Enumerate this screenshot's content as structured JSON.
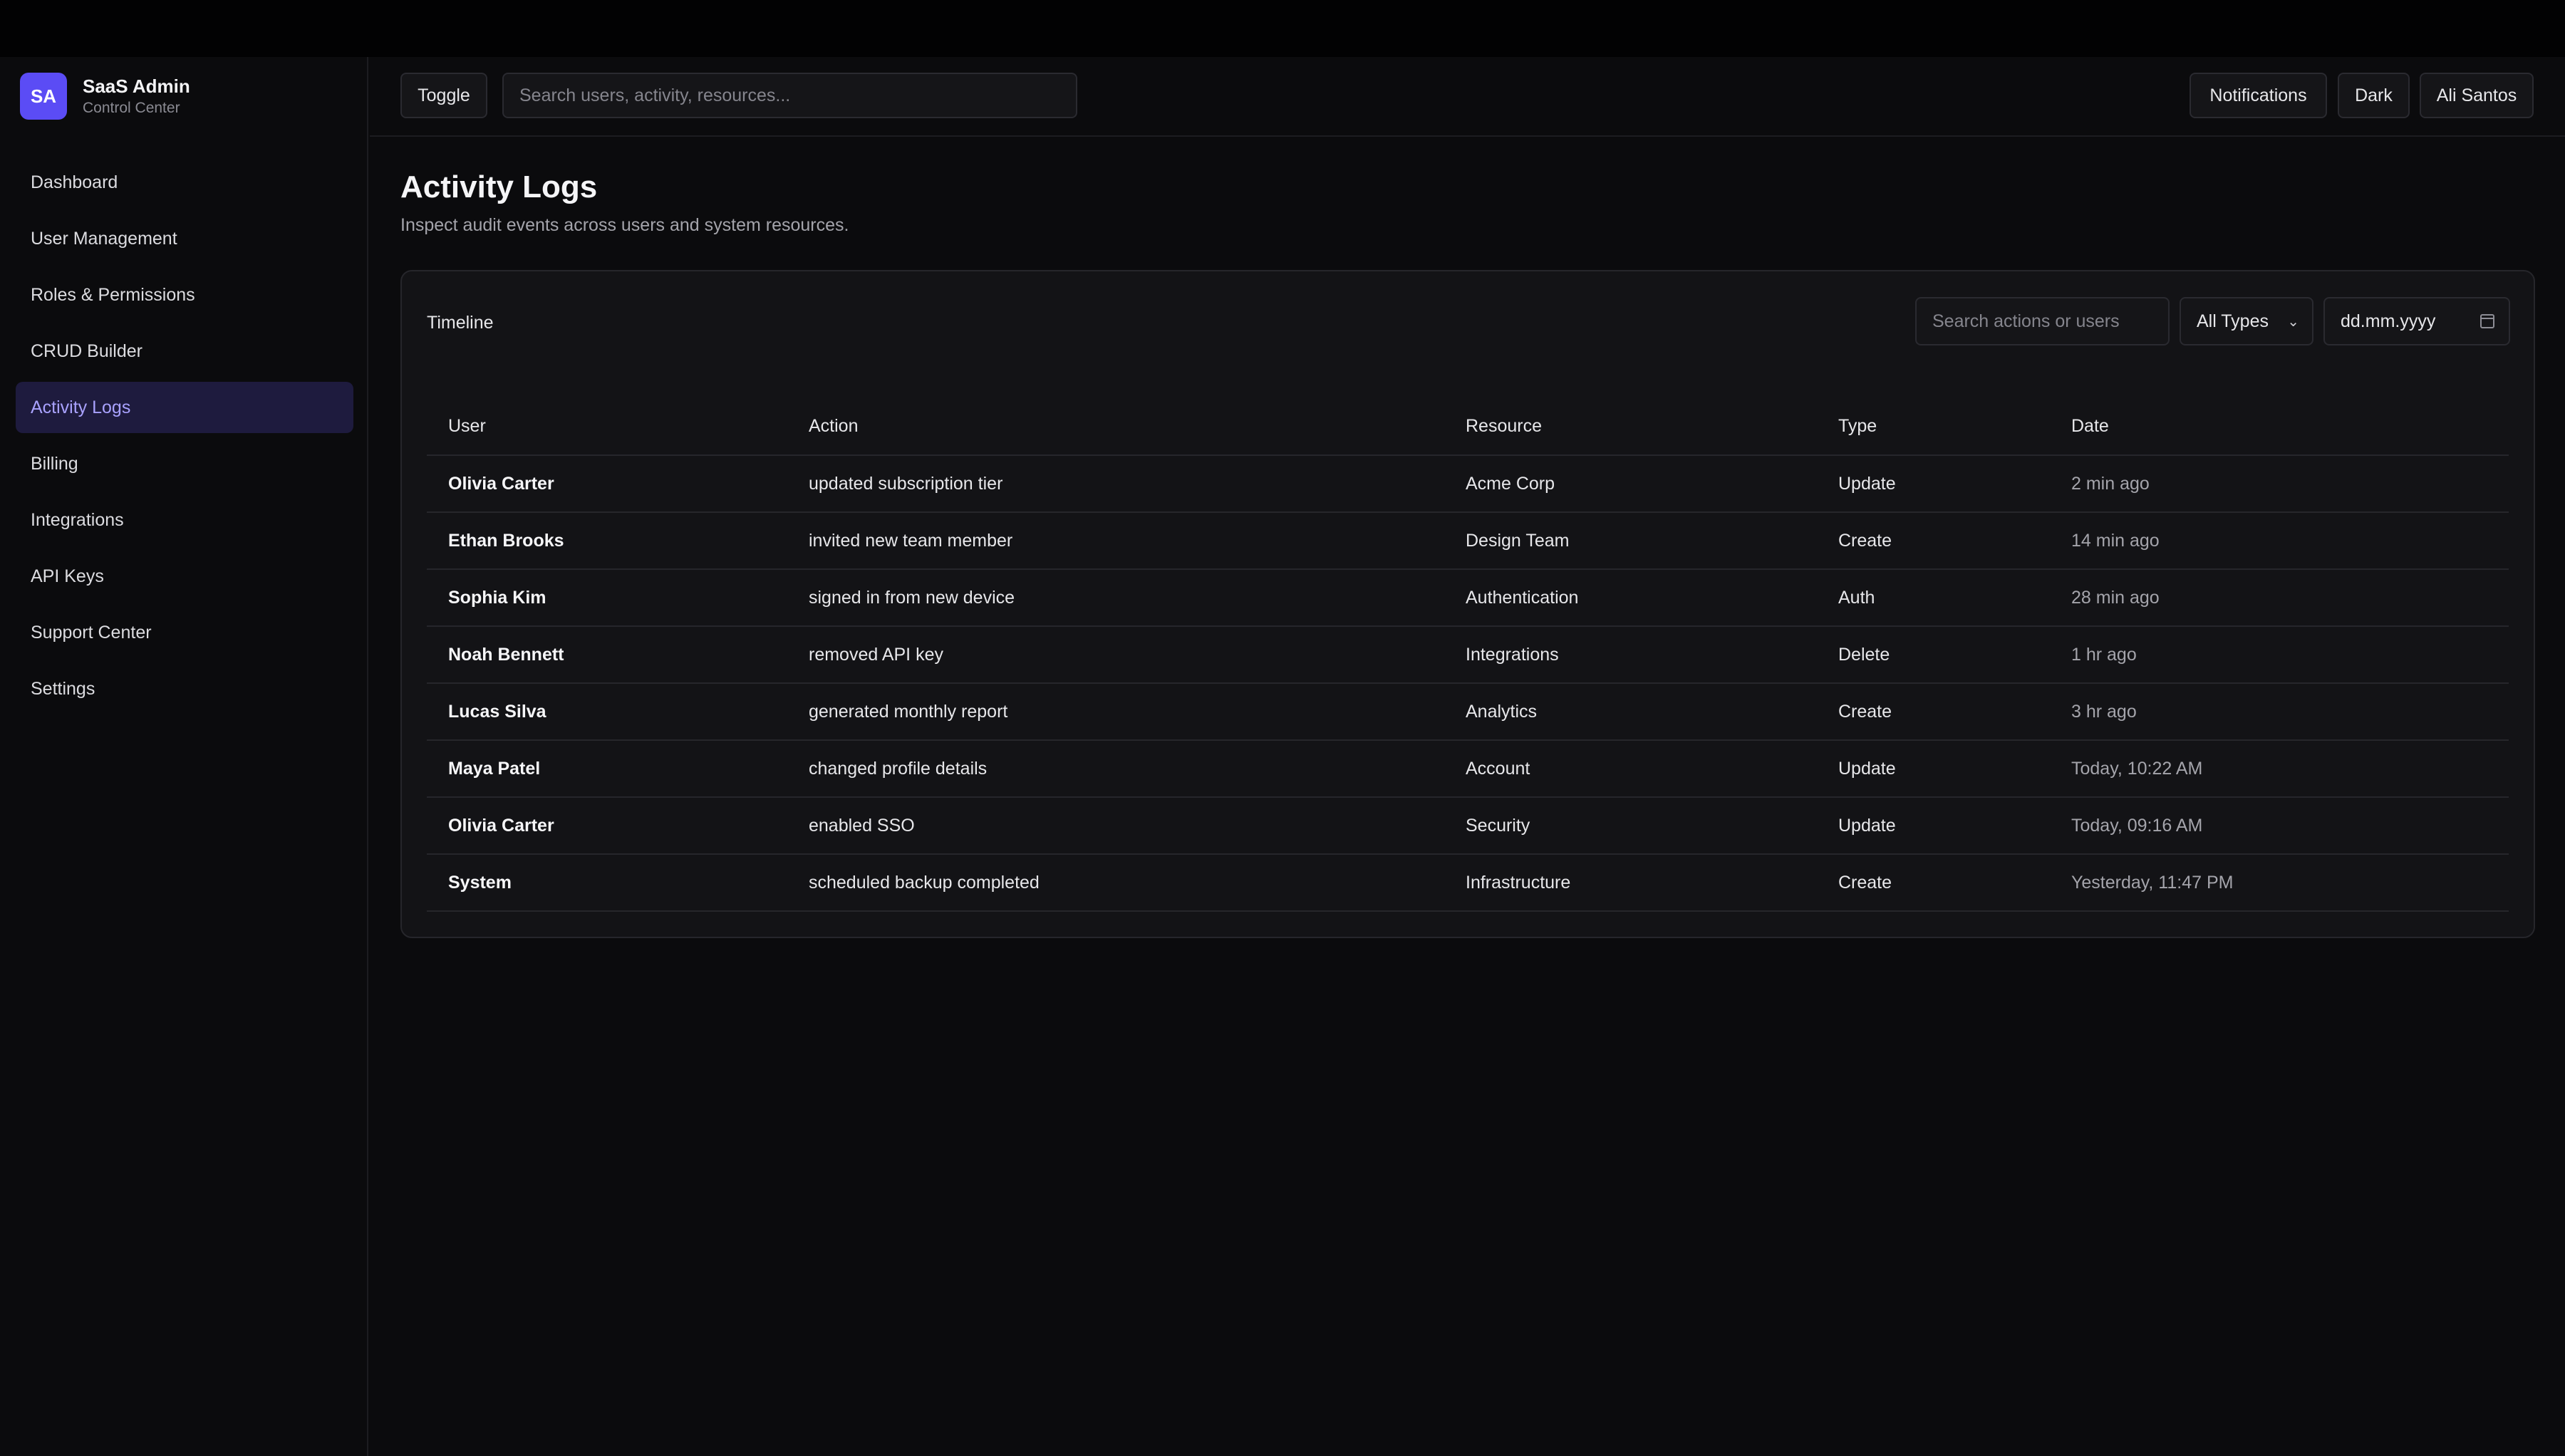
{
  "brand": {
    "badge": "SA",
    "title": "SaaS Admin",
    "subtitle": "Control Center"
  },
  "sidebar": {
    "items": [
      {
        "label": "Dashboard",
        "active": false
      },
      {
        "label": "User Management",
        "active": false
      },
      {
        "label": "Roles & Permissions",
        "active": false
      },
      {
        "label": "CRUD Builder",
        "active": false
      },
      {
        "label": "Activity Logs",
        "active": true
      },
      {
        "label": "Billing",
        "active": false
      },
      {
        "label": "Integrations",
        "active": false
      },
      {
        "label": "API Keys",
        "active": false
      },
      {
        "label": "Support Center",
        "active": false
      },
      {
        "label": "Settings",
        "active": false
      }
    ]
  },
  "topbar": {
    "toggle_label": "Toggle",
    "search_placeholder": "Search users, activity, resources...",
    "notifications_label": "Notifications",
    "theme_label": "Dark",
    "user_label": "Ali Santos"
  },
  "page": {
    "title": "Activity Logs",
    "subtitle": "Inspect audit events across users and system resources."
  },
  "card": {
    "title": "Timeline",
    "search_placeholder": "Search actions or users",
    "type_filter": "All Types",
    "date_placeholder": "dd.mm.yyyy"
  },
  "table": {
    "columns": [
      "User",
      "Action",
      "Resource",
      "Type",
      "Date"
    ],
    "rows": [
      {
        "user": "Olivia Carter",
        "action": "updated subscription tier",
        "resource": "Acme Corp",
        "type": "Update",
        "date": "2 min ago"
      },
      {
        "user": "Ethan Brooks",
        "action": "invited new team member",
        "resource": "Design Team",
        "type": "Create",
        "date": "14 min ago"
      },
      {
        "user": "Sophia Kim",
        "action": "signed in from new device",
        "resource": "Authentication",
        "type": "Auth",
        "date": "28 min ago"
      },
      {
        "user": "Noah Bennett",
        "action": "removed API key",
        "resource": "Integrations",
        "type": "Delete",
        "date": "1 hr ago"
      },
      {
        "user": "Lucas Silva",
        "action": "generated monthly report",
        "resource": "Analytics",
        "type": "Create",
        "date": "3 hr ago"
      },
      {
        "user": "Maya Patel",
        "action": "changed profile details",
        "resource": "Account",
        "type": "Update",
        "date": "Today, 10:22 AM"
      },
      {
        "user": "Olivia Carter",
        "action": "enabled SSO",
        "resource": "Security",
        "type": "Update",
        "date": "Today, 09:16 AM"
      },
      {
        "user": "System",
        "action": "scheduled backup completed",
        "resource": "Infrastructure",
        "type": "Create",
        "date": "Yesterday, 11:47 PM"
      }
    ]
  }
}
